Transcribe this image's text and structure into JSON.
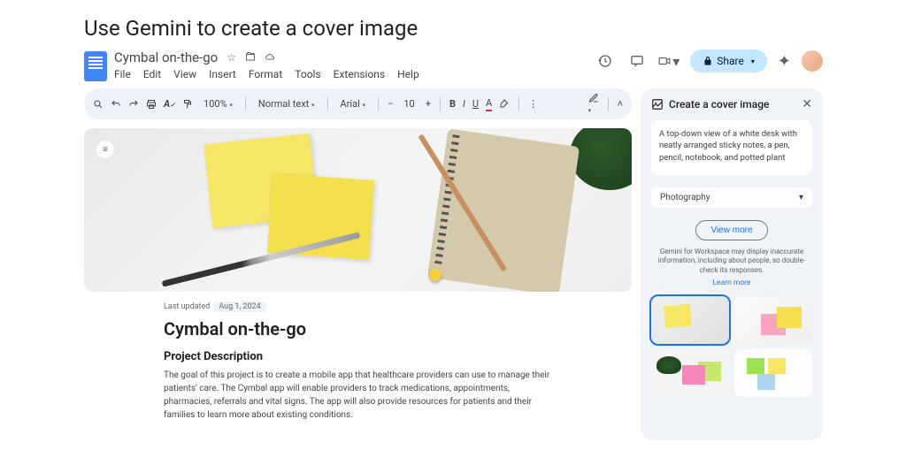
{
  "page_title": "Use Gemini to create a cover image",
  "doc": {
    "title": "Cymbal on-the-go",
    "menu": [
      "File",
      "Edit",
      "View",
      "Insert",
      "Format",
      "Tools",
      "Extensions",
      "Help"
    ],
    "share_label": "Share"
  },
  "toolbar": {
    "zoom": "100%",
    "style": "Normal text",
    "font": "Arial",
    "size": "10"
  },
  "document": {
    "last_updated_label": "Last updated",
    "last_updated_date": "Aug 1, 2024",
    "h1": "Cymbal on-the-go",
    "h2": "Project Description",
    "body": "The goal of this project is to create a mobile app that healthcare providers can use to manage their patients' care.  The Cymbal app will enable providers to track medications, appointments, pharmacies, referrals and vital signs. The app will also provide resources for patients and their families to learn more about existing conditions."
  },
  "panel": {
    "title": "Create a cover image",
    "prompt": "A top-down view of a white desk with neatly arranged sticky notes, a pen, pencil, notebook, and potted plant",
    "style": "Photography",
    "view_more": "View more",
    "disclaimer": "Gemini for Workspace may display inaccurate information, including about people, so double-check its responses.",
    "learn_more": "Learn more"
  }
}
